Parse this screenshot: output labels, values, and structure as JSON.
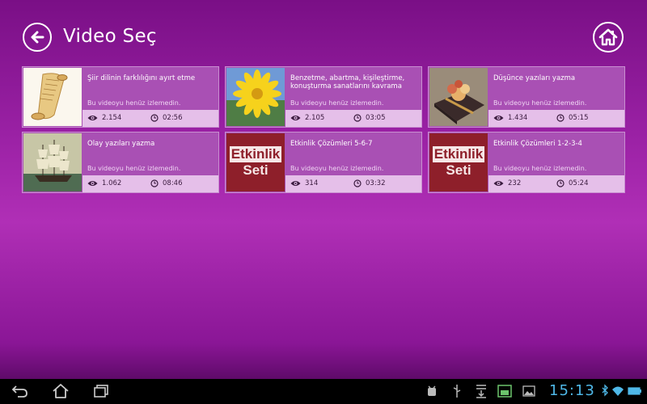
{
  "header": {
    "title": "Video Seç"
  },
  "videos": [
    {
      "title": "Şiir dilinin farklılığını ayırt etme",
      "status": "Bu videoyu henüz izlemedin.",
      "views": "2.154",
      "duration": "02:56",
      "thumb": "scroll-image"
    },
    {
      "title": "Benzetme, abartma, kişileştirme, konuşturma sanatlarını kavrama",
      "status": "Bu videoyu henüz izlemedin.",
      "views": "2.105",
      "duration": "03:05",
      "thumb": "yellow-flower-image"
    },
    {
      "title": "Düşünce yazıları yazma",
      "status": "Bu videoyu henüz izlemedin.",
      "views": "1.434",
      "duration": "05:15",
      "thumb": "gift-book-image"
    },
    {
      "title": "Olay yazıları yazma",
      "status": "Bu videoyu henüz izlemedin.",
      "views": "1.062",
      "duration": "08:46",
      "thumb": "sailing-ship-image"
    },
    {
      "title": "Etkinlik Çözümleri 5-6-7",
      "status": "Bu videoyu henüz izlemedin.",
      "views": "314",
      "duration": "03:32",
      "thumb": "etkinlik-seti-logo",
      "thumb_text": [
        "Etkinlik",
        "Seti"
      ]
    },
    {
      "title": "Etkinlik Çözümleri 1-2-3-4",
      "status": "Bu videoyu henüz izlemedin.",
      "views": "232",
      "duration": "05:24",
      "thumb": "etkinlik-seti-logo",
      "thumb_text": [
        "Etkinlik",
        "Seti"
      ]
    }
  ],
  "system_bar": {
    "time": "15:13"
  },
  "colors": {
    "accent": "#b02fb6",
    "card": "#a950b4",
    "stats_bar": "#e5bfe9",
    "clock": "#4fb8e8"
  }
}
